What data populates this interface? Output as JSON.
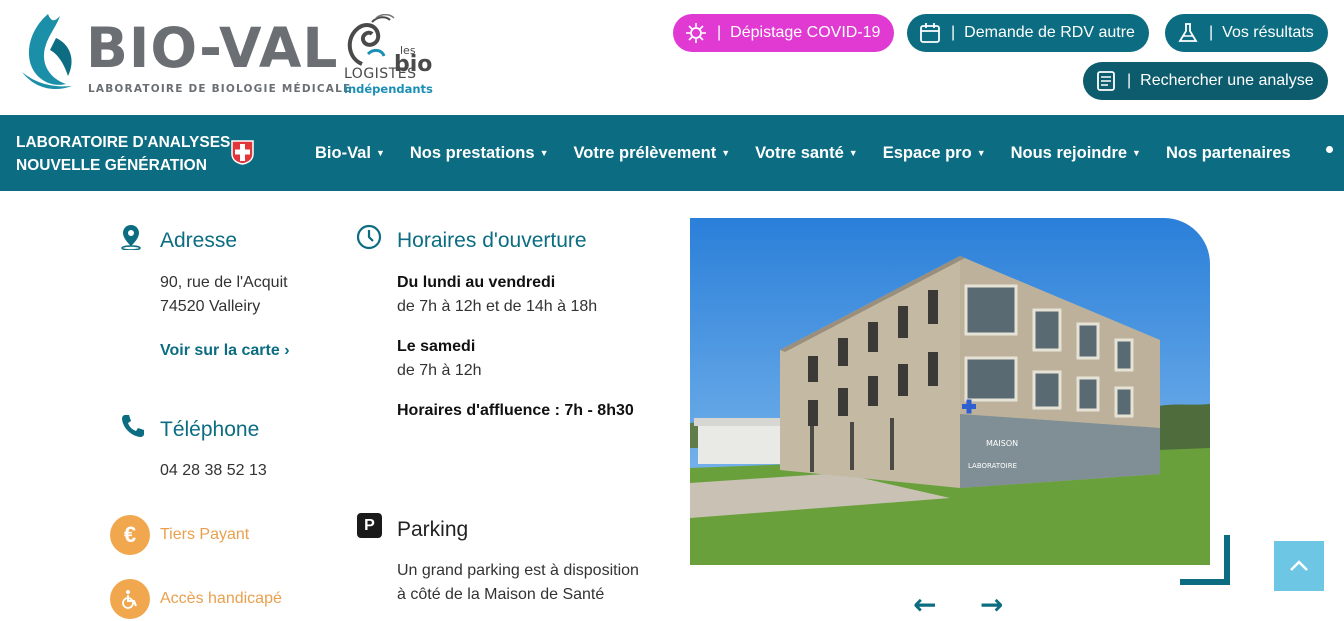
{
  "header": {
    "logo": {
      "name": "BIO-VAL",
      "tagline": "LABORATOIRE DE BIOLOGIE MÉDICALE"
    },
    "partner": {
      "line1": "les",
      "line2": "bio",
      "line3": "LOGISTES",
      "line4": "indépendants"
    },
    "buttons": {
      "covid": {
        "label": "Dépistage COVID-19",
        "sep": "|",
        "icon": "virus-icon",
        "color": "#e03ad3"
      },
      "rdv": {
        "label": "Demande de RDV autre",
        "sep": "|",
        "icon": "calendar-icon",
        "color": "#0c6d82"
      },
      "results": {
        "label": "Vos résultats",
        "sep": "|",
        "icon": "flask-icon",
        "color": "#0c6d82"
      },
      "search": {
        "label": "Rechercher une analyse",
        "sep": "|",
        "icon": "document-icon",
        "color": "#0c5c6e"
      }
    }
  },
  "nav": {
    "brand_line1": "LABORATOIRE D'ANALYSES",
    "brand_line2": "NOUVELLE GÉNÉRATION",
    "items": [
      {
        "label": "Bio-Val",
        "caret": "▼"
      },
      {
        "label": "Nos prestations",
        "caret": "▼"
      },
      {
        "label": "Votre prélèvement",
        "caret": "▼"
      },
      {
        "label": "Votre santé",
        "caret": "▼"
      },
      {
        "label": "Espace pro",
        "caret": "▼"
      },
      {
        "label": "Nous rejoindre",
        "caret": "▼"
      },
      {
        "label": "Nos partenaires"
      }
    ],
    "background": "#0c6d82"
  },
  "address": {
    "title": "Adresse",
    "line1": "90, rue de l'Acquit",
    "line2": "74520 Valleiry",
    "map_link": "Voir sur la carte ›"
  },
  "phone": {
    "title": "Téléphone",
    "number": "04 28 38 52 13"
  },
  "features": {
    "tiers_payant": {
      "label": "Tiers Payant",
      "icon_text": "€"
    },
    "handicap": {
      "label": "Accès handicapé"
    }
  },
  "hours": {
    "title": "Horaires d'ouverture",
    "weekdays_label": "Du lundi au vendredi",
    "weekdays_hours": "de 7h à 12h et de 14h à 18h",
    "saturday_label": "Le samedi",
    "saturday_hours": "de 7h à 12h",
    "rush": "Horaires d'affluence : 7h - 8h30"
  },
  "parking": {
    "title": "Parking",
    "icon_text": "P",
    "line1": "Un grand parking est à disposition",
    "line2": "à côté de la Maison de Santé"
  },
  "carousel": {
    "prev": "←",
    "next": "→"
  },
  "photo_signs": {
    "sign1": "MAISON",
    "sign2": "LABORATOIRE"
  },
  "colors": {
    "primary": "#0c6d82",
    "accent_pink": "#e03ad3",
    "orange": "#f0a74e",
    "scroll_top": "#6cc6e4"
  }
}
